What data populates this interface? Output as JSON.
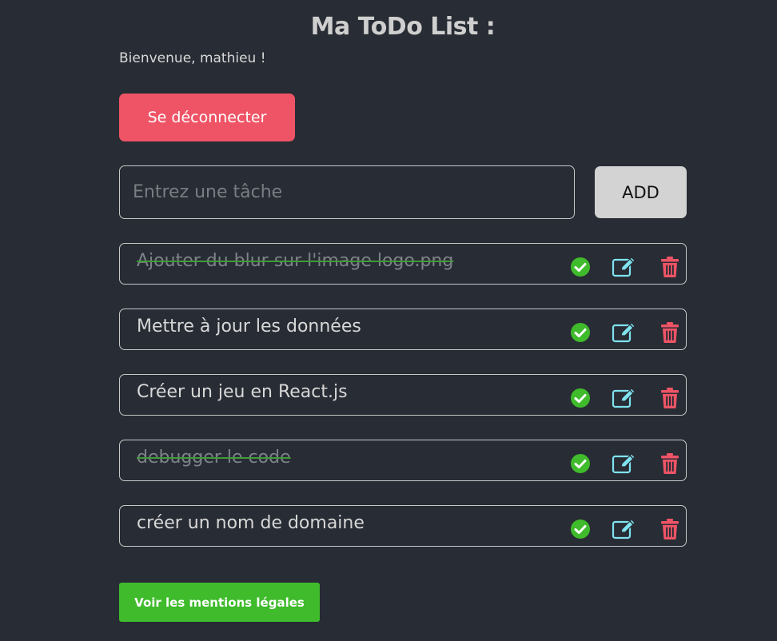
{
  "header": {
    "title": "Ma ToDo List :",
    "welcome": "Bienvenue, mathieu !"
  },
  "actions": {
    "logout_label": "Se déconnecter",
    "add_label": "ADD",
    "legal_label": "Voir les mentions légales"
  },
  "task_input": {
    "value": "",
    "placeholder": "Entrez une tâche"
  },
  "todos": [
    {
      "text": "Ajouter du blur sur l'image logo.png",
      "completed": true
    },
    {
      "text": "Mettre à jour les données",
      "completed": false
    },
    {
      "text": "Créer un jeu en React.js",
      "completed": false
    },
    {
      "text": "debugger le code",
      "completed": true
    },
    {
      "text": "créer un nom de domaine",
      "completed": false
    }
  ],
  "icons": {
    "complete": "check-circle-icon",
    "edit": "edit-icon",
    "delete": "trash-icon"
  },
  "colors": {
    "background": "#282c34",
    "logout": "#ef5466",
    "add": "#d3d3d3",
    "legal": "#3fbb2c",
    "check": "#3fbb2c",
    "edit": "#7fe3f0",
    "delete": "#ef5466"
  }
}
